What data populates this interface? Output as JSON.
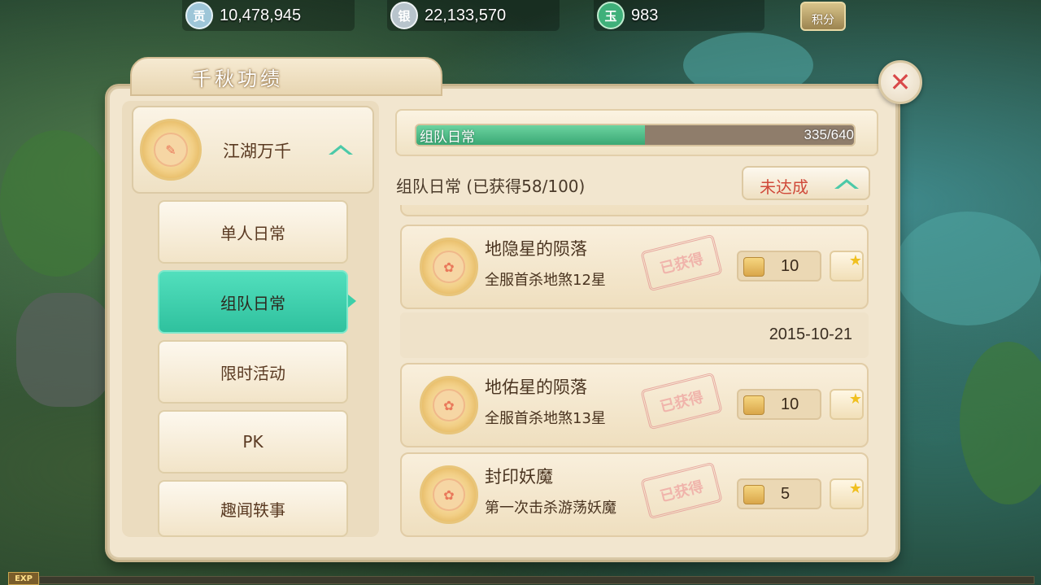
{
  "resources": [
    {
      "icon": "contribution-coin-icon",
      "icon_glyph": "贡",
      "value": "10,478,945",
      "color": "#9ec6d8"
    },
    {
      "icon": "silver-ingot-icon",
      "icon_glyph": "银",
      "value": "22,133,570",
      "color": "#b8c4cc"
    },
    {
      "icon": "jade-icon",
      "icon_glyph": "玉",
      "value": "983",
      "color": "#3fb07a"
    }
  ],
  "score_button": "积分",
  "panel": {
    "title": "千秋功绩"
  },
  "category": {
    "label": "江湖万千"
  },
  "nav": [
    {
      "label": "单人日常",
      "active": false
    },
    {
      "label": "组队日常",
      "active": true
    },
    {
      "label": "限时活动",
      "active": false
    },
    {
      "label": "PK",
      "active": false
    },
    {
      "label": "趣闻轶事",
      "active": false
    }
  ],
  "progress": {
    "name": "组队日常",
    "current": 335,
    "total": 640,
    "text": "335/640",
    "fraction": 0.523
  },
  "section": {
    "title": "组队日常  (已获得58/100)",
    "status": "未达成"
  },
  "achievements": [
    {
      "name": "地隐星的陨落",
      "desc": "全服首杀地煞12星",
      "stamp": "已获得",
      "reward": "10"
    },
    {
      "name": "地佑星的陨落",
      "desc": "全服首杀地煞13星",
      "stamp": "已获得",
      "reward": "10"
    },
    {
      "name": "封印妖魔",
      "desc": "第一次击杀游荡妖魔",
      "stamp": "已获得",
      "reward": "5"
    }
  ],
  "date": "2015-10-21",
  "exp_label": "EXP",
  "colors": {
    "accent_teal": "#3cc9a6",
    "status_red": "#d04a3a",
    "parchment": "#f2e6cf",
    "progress_green": "#4dbb86"
  }
}
